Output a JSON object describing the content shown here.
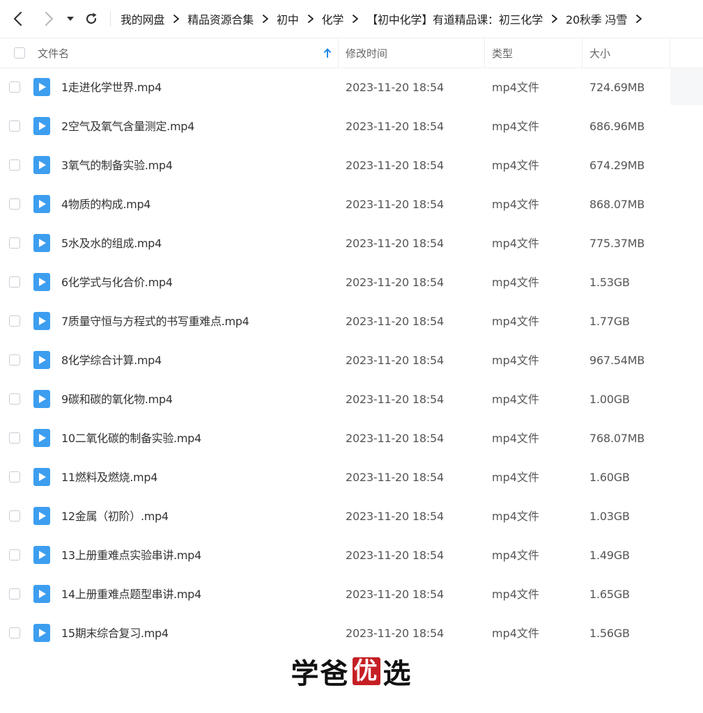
{
  "breadcrumb": [
    "我的网盘",
    "精品资源合集",
    "初中",
    "化学",
    "【初中化学】有道精品课：初三化学",
    "20秋季 冯雪"
  ],
  "columns": {
    "name": "文件名",
    "time": "修改时间",
    "type": "类型",
    "size": "大小"
  },
  "files": [
    {
      "name": "1走进化学世界.mp4",
      "time": "2023-11-20 18:54",
      "type": "mp4文件",
      "size": "724.69MB"
    },
    {
      "name": "2空气及氧气含量测定.mp4",
      "time": "2023-11-20 18:54",
      "type": "mp4文件",
      "size": "686.96MB"
    },
    {
      "name": "3氧气的制备实验.mp4",
      "time": "2023-11-20 18:54",
      "type": "mp4文件",
      "size": "674.29MB"
    },
    {
      "name": "4物质的构成.mp4",
      "time": "2023-11-20 18:54",
      "type": "mp4文件",
      "size": "868.07MB"
    },
    {
      "name": "5水及水的组成.mp4",
      "time": "2023-11-20 18:54",
      "type": "mp4文件",
      "size": "775.37MB"
    },
    {
      "name": "6化学式与化合价.mp4",
      "time": "2023-11-20 18:54",
      "type": "mp4文件",
      "size": "1.53GB"
    },
    {
      "name": "7质量守恒与方程式的书写重难点.mp4",
      "time": "2023-11-20 18:54",
      "type": "mp4文件",
      "size": "1.77GB"
    },
    {
      "name": "8化学综合计算.mp4",
      "time": "2023-11-20 18:54",
      "type": "mp4文件",
      "size": "967.54MB"
    },
    {
      "name": "9碳和碳的氧化物.mp4",
      "time": "2023-11-20 18:54",
      "type": "mp4文件",
      "size": "1.00GB"
    },
    {
      "name": "10二氧化碳的制备实验.mp4",
      "time": "2023-11-20 18:54",
      "type": "mp4文件",
      "size": "768.07MB"
    },
    {
      "name": "11燃料及燃烧.mp4",
      "time": "2023-11-20 18:54",
      "type": "mp4文件",
      "size": "1.60GB"
    },
    {
      "name": "12金属（初阶）.mp4",
      "time": "2023-11-20 18:54",
      "type": "mp4文件",
      "size": "1.03GB"
    },
    {
      "name": "13上册重难点实验串讲.mp4",
      "time": "2023-11-20 18:54",
      "type": "mp4文件",
      "size": "1.49GB"
    },
    {
      "name": "14上册重难点题型串讲.mp4",
      "time": "2023-11-20 18:54",
      "type": "mp4文件",
      "size": "1.65GB"
    },
    {
      "name": "15期末综合复习.mp4",
      "time": "2023-11-20 18:54",
      "type": "mp4文件",
      "size": "1.56GB"
    }
  ],
  "watermark": {
    "part1": "学爸",
    "part2": "优",
    "part3": "选"
  },
  "colors": {
    "file_icon": "#3d9ef0",
    "sort_arrow": "#1e88e5",
    "watermark_red": "#c51f24"
  },
  "icons": {
    "back": "chevron-left-icon",
    "forward": "chevron-right-icon",
    "history": "caret-down-icon",
    "refresh": "refresh-icon",
    "sort": "sort-ascending-icon",
    "file": "video-file-icon"
  }
}
